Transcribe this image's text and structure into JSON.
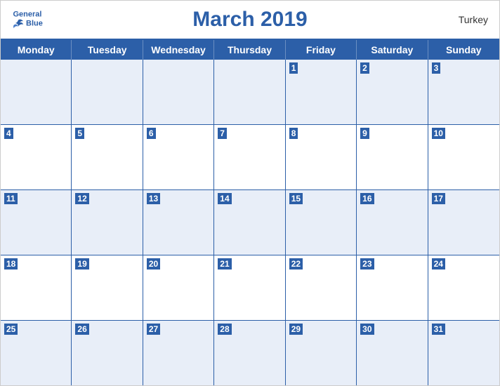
{
  "header": {
    "logo_general": "General",
    "logo_blue": "Blue",
    "title": "March 2019",
    "country": "Turkey"
  },
  "days_of_week": [
    "Monday",
    "Tuesday",
    "Wednesday",
    "Thursday",
    "Friday",
    "Saturday",
    "Sunday"
  ],
  "weeks": [
    [
      {
        "num": "",
        "empty": true
      },
      {
        "num": "",
        "empty": true
      },
      {
        "num": "",
        "empty": true
      },
      {
        "num": "",
        "empty": true
      },
      {
        "num": "1"
      },
      {
        "num": "2"
      },
      {
        "num": "3"
      }
    ],
    [
      {
        "num": "4"
      },
      {
        "num": "5"
      },
      {
        "num": "6"
      },
      {
        "num": "7"
      },
      {
        "num": "8"
      },
      {
        "num": "9"
      },
      {
        "num": "10"
      }
    ],
    [
      {
        "num": "11"
      },
      {
        "num": "12"
      },
      {
        "num": "13"
      },
      {
        "num": "14"
      },
      {
        "num": "15"
      },
      {
        "num": "16"
      },
      {
        "num": "17"
      }
    ],
    [
      {
        "num": "18"
      },
      {
        "num": "19"
      },
      {
        "num": "20"
      },
      {
        "num": "21"
      },
      {
        "num": "22"
      },
      {
        "num": "23"
      },
      {
        "num": "24"
      }
    ],
    [
      {
        "num": "25"
      },
      {
        "num": "26"
      },
      {
        "num": "27"
      },
      {
        "num": "28"
      },
      {
        "num": "29"
      },
      {
        "num": "30"
      },
      {
        "num": "31"
      }
    ]
  ],
  "colors": {
    "primary": "#2c5fa8",
    "header_bg": "#2c5fa8",
    "row_alt": "#e8eef8",
    "row_white": "#ffffff"
  }
}
